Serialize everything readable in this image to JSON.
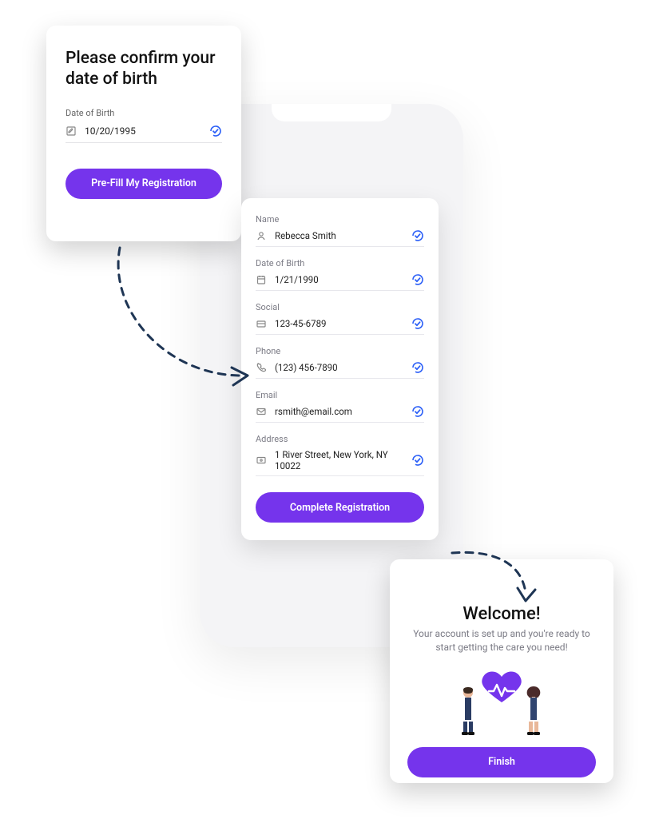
{
  "colors": {
    "accent": "#7534ec",
    "check": "#2b5ff7",
    "arrow": "#1e3554"
  },
  "card1": {
    "title": "Please confirm your date of birth",
    "dob_label": "Date of Birth",
    "dob_value": "10/20/1995",
    "button": "Pre-Fill My Registration"
  },
  "card2": {
    "fields": [
      {
        "label": "Name",
        "value": "Rebecca Smith",
        "icon": "user"
      },
      {
        "label": "Date of Birth",
        "value": "1/21/1990",
        "icon": "calendar"
      },
      {
        "label": "Social",
        "value": "123-45-6789",
        "icon": "card"
      },
      {
        "label": "Phone",
        "value": "(123) 456-7890",
        "icon": "phone"
      },
      {
        "label": "Email",
        "value": "rsmith@email.com",
        "icon": "mail"
      },
      {
        "label": "Address",
        "value": "1 River Street, New York, NY 10022",
        "icon": "map"
      }
    ],
    "button": "Complete Registration"
  },
  "card3": {
    "title": "Welcome!",
    "subtitle": "Your account is set up and you're ready to start getting the care you need!",
    "button": "Finish"
  }
}
